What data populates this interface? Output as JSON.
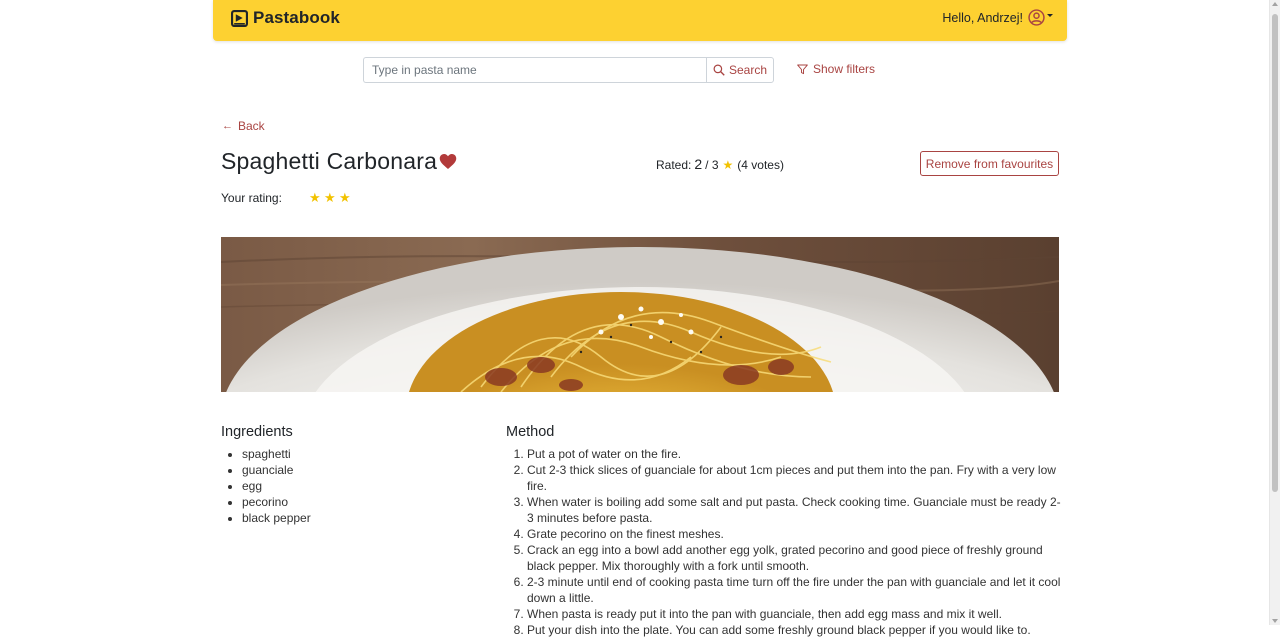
{
  "navbar": {
    "brand": "Pastabook",
    "greeting": "Hello, Andrzej!",
    "bg_color": "#fdd131"
  },
  "search": {
    "placeholder": "Type in pasta name",
    "button_label": "Search",
    "filters_label": "Show filters"
  },
  "recipe": {
    "back_label": "Back",
    "title": "Spaghetti Carbonara",
    "favourite": true,
    "rated_label": "Rated:",
    "rating_value": "2",
    "rating_max": "/ 3",
    "votes": "(4 votes)",
    "favourite_button": "Remove from favourites",
    "your_rating_label": "Your rating:",
    "your_rating_stars": 3,
    "accent_color": "#a94442",
    "star_color": "#f2c200"
  },
  "ingredients": {
    "title": "Ingredients",
    "items": [
      "spaghetti",
      "guanciale",
      "egg",
      "pecorino",
      "black pepper"
    ]
  },
  "method": {
    "title": "Method",
    "steps": [
      "Put a pot of water on the fire.",
      "Cut 2-3 thick slices of guanciale for about 1cm pieces and put them into the pan. Fry with a very low fire.",
      "When water is boiling add some salt and put pasta. Check cooking time. Guanciale must be ready 2-3 minutes before pasta.",
      "Grate pecorino on the finest meshes.",
      "Crack an egg into a bowl add another egg yolk, grated pecorino and good piece of freshly ground black pepper. Mix thoroughly with a fork until smooth.",
      "2-3 minute until end of cooking pasta time turn off the fire under the pan with guanciale and let it cool down a little.",
      "When pasta is ready put it into the pan with guanciale, then add egg mass and mix it well.",
      "Put your dish into the plate. You can add some freshly ground black pepper if you would like to."
    ]
  }
}
